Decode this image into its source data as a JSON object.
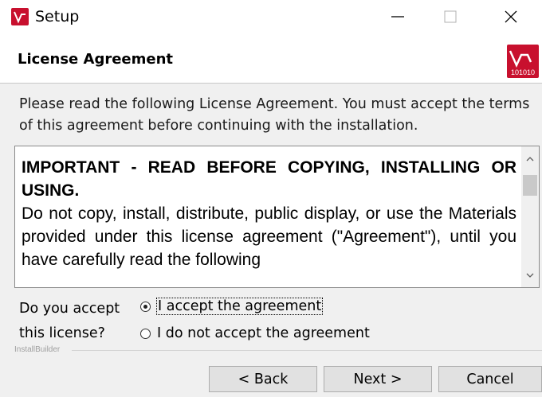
{
  "window": {
    "title": "Setup",
    "controls": {
      "minimize": "minimize-icon",
      "maximize": "maximize-icon",
      "close": "close-icon"
    }
  },
  "header": {
    "title": "License Agreement",
    "logo_text": "101010"
  },
  "description": "Please read the following License Agreement. You must accept the terms of this agreement before continuing with the installation.",
  "license": {
    "heading": "IMPORTANT - READ BEFORE COPYING, INSTALLING OR USING.",
    "body": "Do not copy, install, distribute, public display, or use the Materials provided under this license agreement (\"Agreement\"), until you have carefully read the following"
  },
  "accept": {
    "question": "Do you accept this license?",
    "options": [
      {
        "label": "I accept the agreement",
        "selected": true
      },
      {
        "label": "I do not accept the agreement",
        "selected": false
      }
    ]
  },
  "footer": {
    "brand": "InstallBuilder",
    "back_label": "< Back",
    "next_label": "Next >",
    "cancel_label": "Cancel"
  },
  "colors": {
    "brand_red": "#c8102e",
    "window_bg": "#f0f0f0",
    "button_bg": "#e1e1e1"
  }
}
